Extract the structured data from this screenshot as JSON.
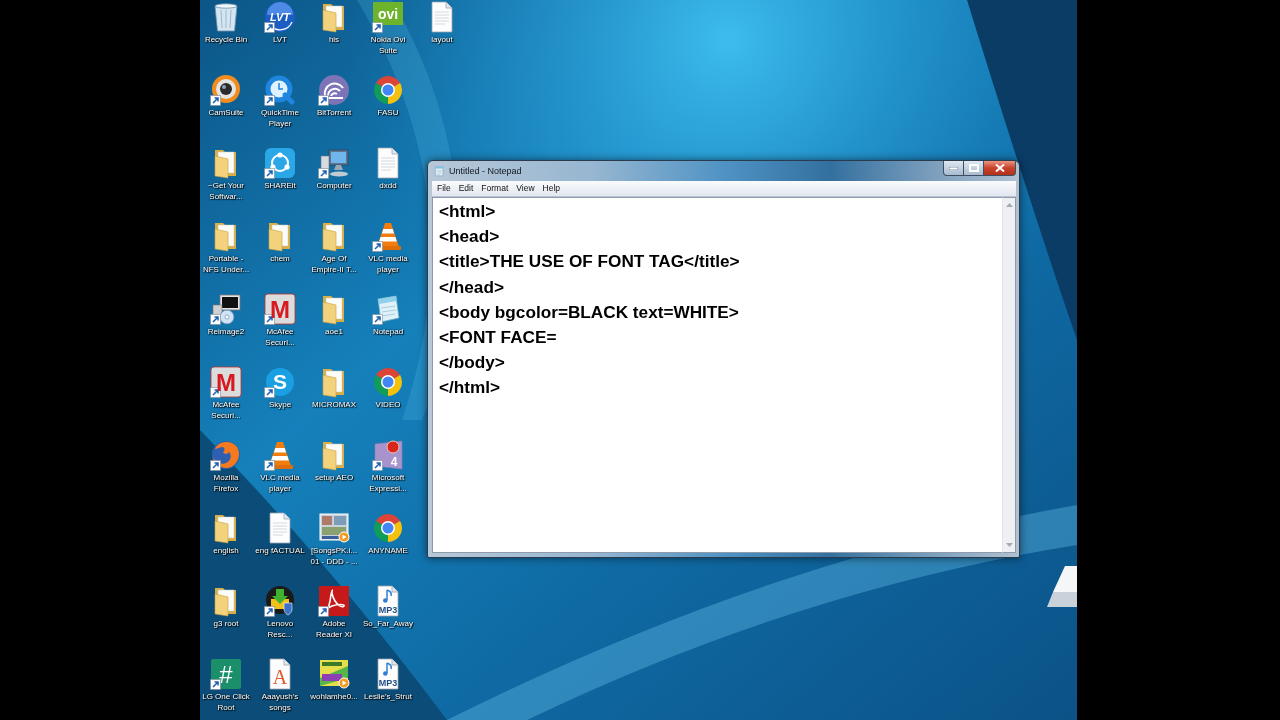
{
  "desktop": {
    "icons": [
      {
        "kind": "recycle-bin",
        "label": [
          "Recycle Bin"
        ],
        "shortcut": false
      },
      {
        "kind": "webcam",
        "label": [
          "CamSuite"
        ],
        "shortcut": true
      },
      {
        "kind": "folder",
        "label": [
          "~Get Your",
          "Softwar..."
        ],
        "shortcut": false
      },
      {
        "kind": "folder",
        "label": [
          "Portable -",
          "NFS Under..."
        ],
        "shortcut": false
      },
      {
        "kind": "computer-disc",
        "label": [
          "Reimage2"
        ],
        "shortcut": true
      },
      {
        "kind": "letter-tile",
        "glyph": "M",
        "label": [
          "McAfee",
          "Securi..."
        ],
        "shortcut": true
      },
      {
        "kind": "firefox",
        "label": [
          "Mozilla",
          "Firefox"
        ],
        "shortcut": true
      },
      {
        "kind": "folder",
        "label": [
          "english"
        ],
        "shortcut": false
      },
      {
        "kind": "folder",
        "label": [
          "g3 root"
        ],
        "shortcut": false
      },
      {
        "kind": "hash-tile",
        "glyph": "#",
        "label": [
          "LG One Click",
          "Root"
        ],
        "shortcut": true
      },
      {
        "kind": "lettered-disc",
        "glyph": "LVT",
        "label": [
          "LVT"
        ],
        "shortcut": true
      },
      {
        "kind": "quicktime",
        "label": [
          "QuickTime",
          "Player"
        ],
        "shortcut": true
      },
      {
        "kind": "share",
        "label": [
          "SHAREit"
        ],
        "shortcut": true
      },
      {
        "kind": "folder",
        "label": [
          "chem"
        ],
        "shortcut": false
      },
      {
        "kind": "letter-tile",
        "glyph": "M",
        "label": [
          "McAfee",
          "Securi..."
        ],
        "shortcut": true
      },
      {
        "kind": "skype",
        "glyph": "S",
        "label": [
          "Skype"
        ],
        "shortcut": true
      },
      {
        "kind": "cone",
        "label": [
          "VLC media",
          "player"
        ],
        "shortcut": true
      },
      {
        "kind": "document",
        "label": [
          "eng fACTUAL"
        ],
        "shortcut": false
      },
      {
        "kind": "rescue",
        "label": [
          "Lenovo",
          "Resc..."
        ],
        "shortcut": true
      },
      {
        "kind": "letter-doc",
        "glyph": "A",
        "label": [
          "Aaayush's",
          "songs"
        ],
        "shortcut": false
      },
      {
        "kind": "folder",
        "label": [
          "his"
        ],
        "shortcut": false
      },
      {
        "kind": "wave-disc",
        "label": [
          "BitTorrent"
        ],
        "shortcut": true
      },
      {
        "kind": "computer",
        "label": [
          "Computer"
        ],
        "shortcut": true
      },
      {
        "kind": "folder",
        "label": [
          "Age Of",
          "Empire-II T..."
        ],
        "shortcut": false
      },
      {
        "kind": "folder",
        "label": [
          "aoe1"
        ],
        "shortcut": false
      },
      {
        "kind": "folder",
        "label": [
          "MICROMAX"
        ],
        "shortcut": false
      },
      {
        "kind": "folder",
        "label": [
          "setup AEO"
        ],
        "shortcut": false
      },
      {
        "kind": "video-thumb",
        "label": [
          "[SongsPK.i...",
          "01 - DDD - ..."
        ],
        "shortcut": false
      },
      {
        "kind": "swirl-tile",
        "label": [
          "Adobe",
          "Reader XI"
        ],
        "shortcut": true
      },
      {
        "kind": "album-thumb",
        "label": [
          "wohlamhe0..."
        ],
        "shortcut": false
      },
      {
        "kind": "text-tile",
        "glyph": "ovi",
        "label": [
          "Nokia Ovi",
          "Suite"
        ],
        "shortcut": true
      },
      {
        "kind": "ring-logo",
        "label": [
          "FASU"
        ],
        "shortcut": false
      },
      {
        "kind": "document",
        "label": [
          "dxdd"
        ],
        "shortcut": false
      },
      {
        "kind": "cone",
        "label": [
          "VLC media",
          "player"
        ],
        "shortcut": true
      },
      {
        "kind": "notepad",
        "label": [
          "Notepad"
        ],
        "shortcut": true
      },
      {
        "kind": "ring-logo",
        "label": [
          "VIDEO"
        ],
        "shortcut": false
      },
      {
        "kind": "app-tile",
        "glyph": "4",
        "label": [
          "Microsoft",
          "Expressi..."
        ],
        "shortcut": true
      },
      {
        "kind": "ring-logo",
        "label": [
          "ANYNAME"
        ],
        "shortcut": false
      },
      {
        "kind": "music-file",
        "glyph": "MP3",
        "label": [
          "So_Far_Away"
        ],
        "shortcut": false
      },
      {
        "kind": "music-file",
        "glyph": "MP3",
        "label": [
          "Leslie's_Strut"
        ],
        "shortcut": false
      },
      {
        "kind": "document",
        "label": [
          "layout"
        ],
        "shortcut": false
      }
    ]
  },
  "notepad": {
    "title": "Untitled - Notepad",
    "menu": [
      "File",
      "Edit",
      "Format",
      "View",
      "Help"
    ],
    "lines": [
      "<html>",
      "<head>",
      "<title>THE USE OF FONT TAG</title>",
      "</head>",
      "<body bgcolor=BLACK text=WHITE>",
      "<FONT FACE=",
      "</body>",
      "</html>"
    ]
  }
}
